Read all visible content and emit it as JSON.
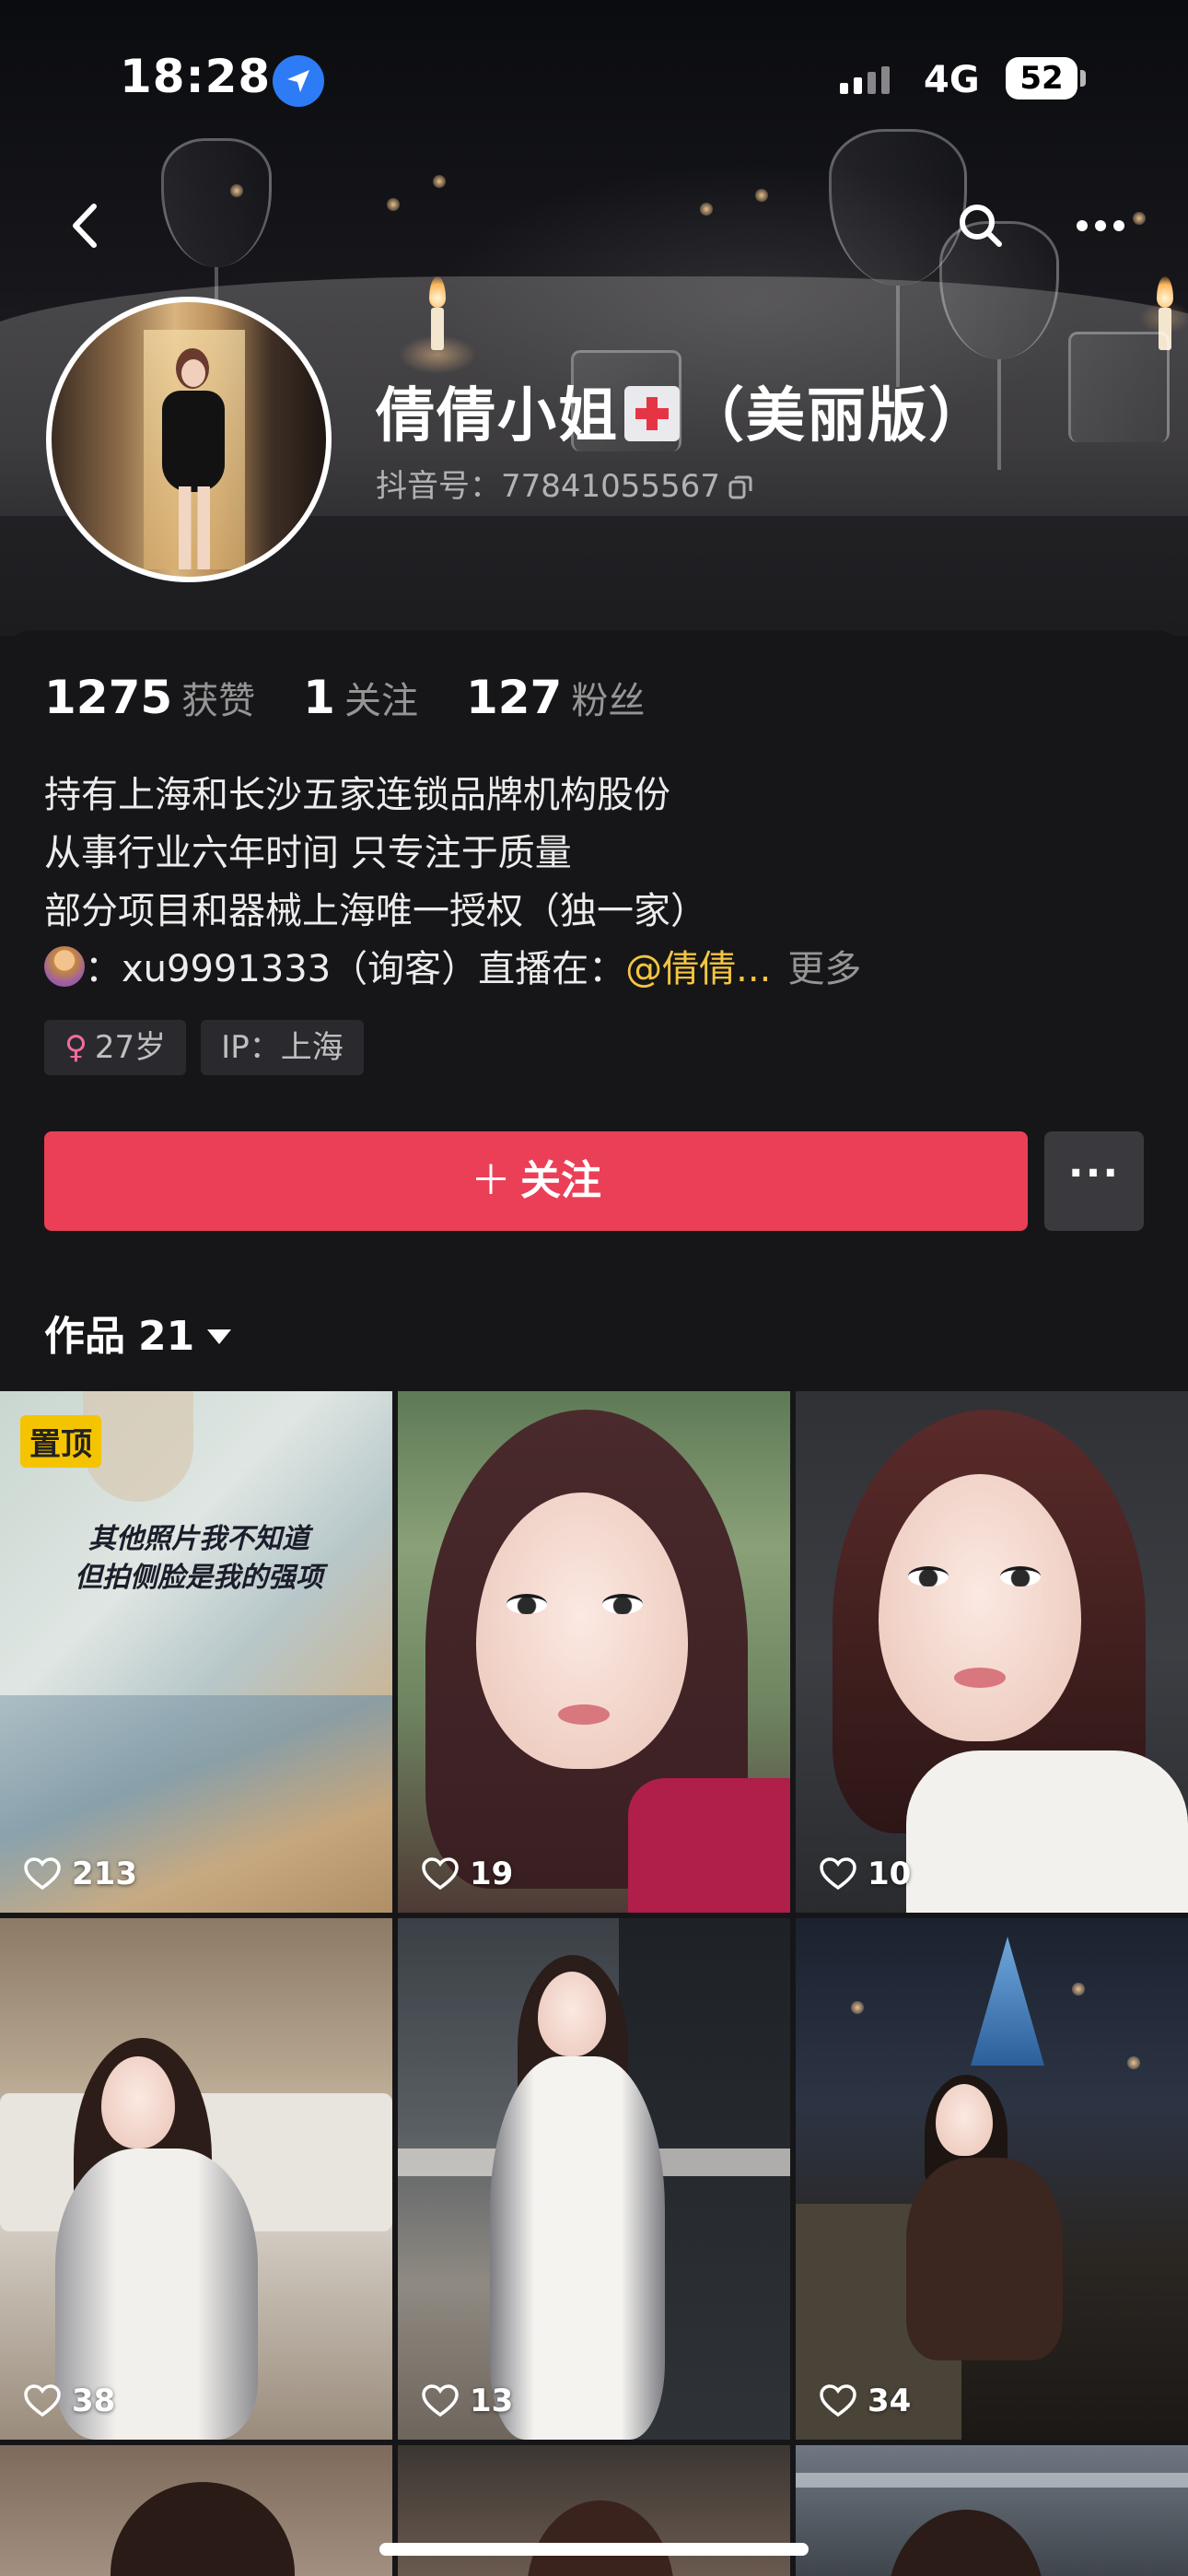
{
  "status_bar": {
    "time": "18:28",
    "network": "4G",
    "battery": "52"
  },
  "profile": {
    "nickname_main": "倩倩小姐",
    "nickname_suffix": "（美丽版）",
    "douyin_id": "抖音号：77841055567",
    "stats": [
      {
        "value": "1275",
        "label": "获赞"
      },
      {
        "value": "1",
        "label": "关注"
      },
      {
        "value": "127",
        "label": "粉丝"
      }
    ],
    "bio_lines": [
      "持有上海和长沙五家连锁品牌机构股份",
      "从事行业六年时间 只专注于质量",
      "部分项目和器械上海唯一授权（独一家）"
    ],
    "bio_last_line": {
      "prefix": "：xu9991333（询客）直播在：",
      "mention": "@倩倩...",
      "more": "更多"
    },
    "tags": [
      {
        "icon": "female-icon",
        "symbol": "♀",
        "text": "27岁"
      },
      {
        "text": "IP：上海"
      }
    ],
    "follow_button": {
      "plus": "＋",
      "label": "关注"
    },
    "more_button": "···"
  },
  "works_tab": {
    "label": "作品",
    "count": "21"
  },
  "videos": [
    {
      "pinned": "置顶",
      "caption": [
        "其他照片我不知道",
        "但拍侧脸是我的强项"
      ],
      "likes": "213"
    },
    {
      "likes": "19"
    },
    {
      "likes": "10"
    },
    {
      "likes": "38"
    },
    {
      "likes": "13"
    },
    {
      "likes": "34"
    }
  ],
  "colors": {
    "follow": "#ea3f57",
    "mention": "#f5c542",
    "pin": "#f5c400",
    "background": "#161618"
  }
}
